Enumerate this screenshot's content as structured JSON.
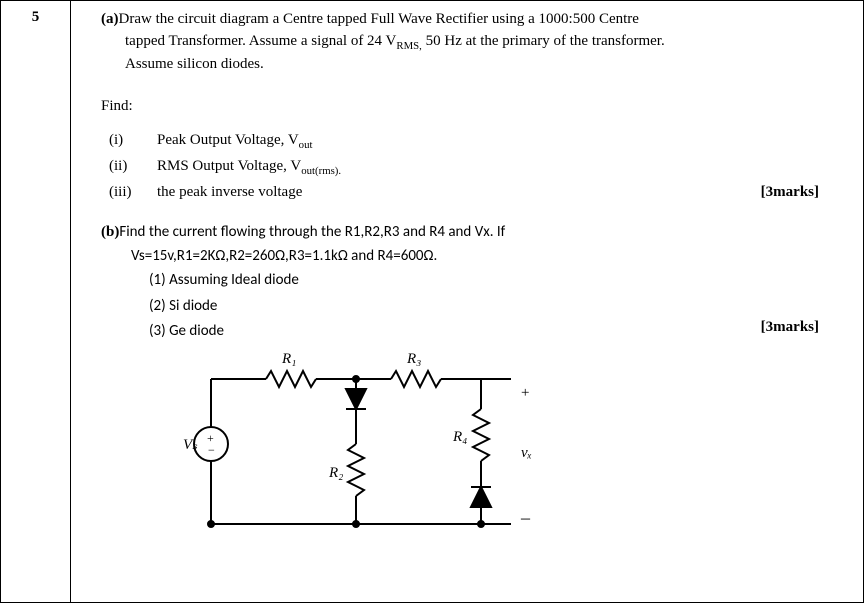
{
  "question_number": "5",
  "part_a": {
    "label": "(a)",
    "line1": "Draw the circuit diagram a Centre tapped Full Wave Rectifier using a 1000:500 Centre",
    "line2_prefix": "tapped Transformer. Assume a signal of 24 V",
    "line2_sub": "RMS,",
    "line2_suffix": " 50 Hz at the primary of the transformer.",
    "line3": "Assume silicon diodes.",
    "find_label": "Find:",
    "items": {
      "i_roman": "(i)",
      "i_text_a": "Peak Output Voltage, V",
      "i_text_sub": "out",
      "ii_roman": "(ii)",
      "ii_text_a": "RMS Output Voltage, V",
      "ii_text_sub": "out(rms).",
      "iii_roman": "(iii)",
      "iii_text": "the peak inverse voltage"
    },
    "marks": "[3marks]"
  },
  "part_b": {
    "label": "(b)",
    "line1": "Find the current flowing through the R1,R2,R3 and R4 and Vx. If",
    "line2": "Vs=15v,R1=2KΩ,R2=260Ω,R3=1.1kΩ and R4=600Ω.",
    "opt1": "(1) Assuming Ideal diode",
    "opt2": "(2) Si diode",
    "opt3": "(3) Ge diode",
    "marks": "[3marks]"
  },
  "circuit": {
    "R1": "R₁",
    "R2": "R₂",
    "R3": "R₃",
    "R4": "R₄",
    "Vs": "Vₛ",
    "vx": "vₓ",
    "plus": "+",
    "minus": "_"
  }
}
